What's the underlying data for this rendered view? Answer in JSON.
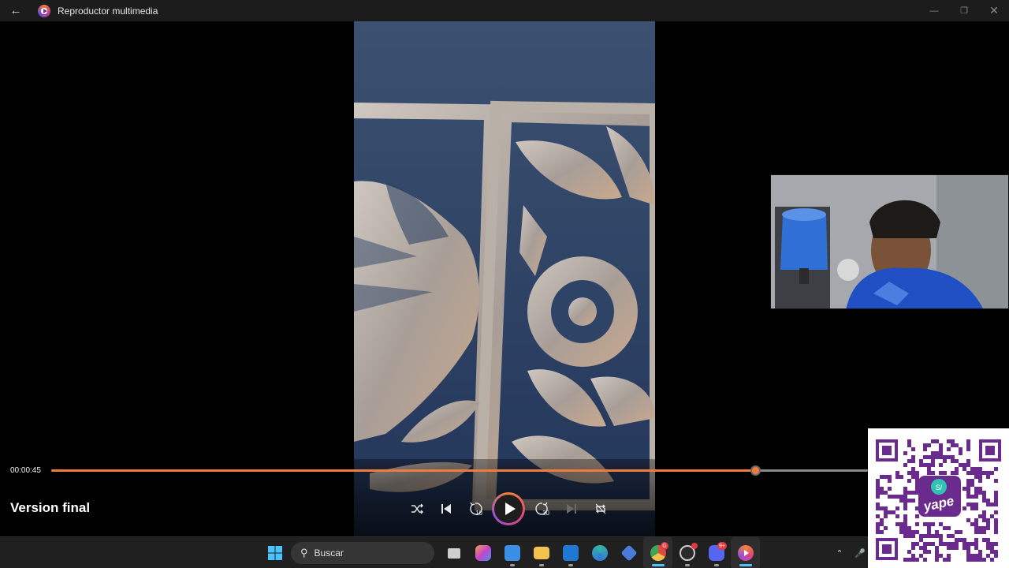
{
  "window": {
    "title": "Reproductor multimedia",
    "back_icon": "back-arrow-icon",
    "controls": [
      "minimize-icon",
      "restore-icon",
      "close-icon"
    ]
  },
  "player": {
    "current_time": "00:00:45",
    "progress": 0.862,
    "media_title": "Version final",
    "accent": "#f07b3f",
    "controls": [
      {
        "name": "shuffle-icon",
        "enabled": true
      },
      {
        "name": "previous-icon",
        "enabled": true
      },
      {
        "name": "skip-back-10-icon",
        "label": "10",
        "enabled": true
      },
      {
        "name": "play-icon",
        "enabled": true
      },
      {
        "name": "skip-forward-30-icon",
        "label": "30",
        "enabled": true
      },
      {
        "name": "next-icon",
        "enabled": false
      },
      {
        "name": "repeat-icon",
        "enabled": true
      }
    ]
  },
  "overlay": {
    "qr_brand": "yape",
    "qr_currency": "S/"
  },
  "taskbar": {
    "search_placeholder": "Buscar",
    "icons": [
      {
        "name": "windows-start-icon",
        "color": "#4cc2ff"
      },
      {
        "name": "task-view-icon",
        "color": "#cfcfcf"
      },
      {
        "name": "copilot-icon",
        "color": "#7c6cf0"
      },
      {
        "name": "microsoft-store-icon",
        "color": "#3a8ee6"
      },
      {
        "name": "file-explorer-icon",
        "color": "#f2c14e"
      },
      {
        "name": "outlook-icon",
        "color": "#1f78d1"
      },
      {
        "name": "edge-icon",
        "color": "#35b3a3"
      },
      {
        "name": "vscode-icon",
        "color": "#4a7bd8"
      },
      {
        "name": "chrome-icon",
        "color": "#e04a3a",
        "badge": "G",
        "active": true
      },
      {
        "name": "obs-icon",
        "color": "#cccccc",
        "badge": ""
      },
      {
        "name": "discord-icon",
        "color": "#5865f2",
        "badge": "9+"
      },
      {
        "name": "media-player-icon",
        "color": "#f07b3f",
        "active": true
      }
    ],
    "tray": [
      "chevron-up-icon",
      "microphone-icon"
    ]
  }
}
